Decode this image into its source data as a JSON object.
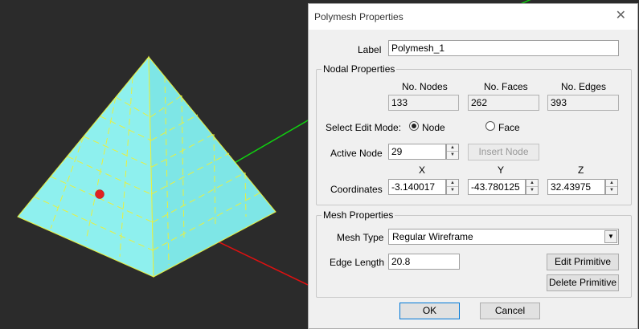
{
  "dialog": {
    "title": "Polymesh Properties",
    "label_caption": "Label",
    "label_value": "Polymesh_1",
    "nodal": {
      "title": "Nodal Properties",
      "nodes_header": "No. Nodes",
      "faces_header": "No. Faces",
      "edges_header": "No. Edges",
      "nodes_value": "133",
      "faces_value": "262",
      "edges_value": "393",
      "edit_mode_label": "Select Edit Mode:",
      "mode_node": "Node",
      "mode_face": "Face",
      "mode_selected": "Node",
      "active_node_label": "Active Node",
      "active_node_value": "29",
      "insert_node_label": "Insert Node",
      "x_header": "X",
      "y_header": "Y",
      "z_header": "Z",
      "coordinates_label": "Coordinates",
      "x_value": "-3.140017",
      "y_value": "-43.780125",
      "z_value": "32.43975"
    },
    "mesh": {
      "title": "Mesh Properties",
      "mesh_type_label": "Mesh Type",
      "mesh_type_value": "Regular Wireframe",
      "edge_length_label": "Edge Length",
      "edge_length_value": "20.8",
      "edit_primitive_label": "Edit Primitive",
      "delete_primitive_label": "Delete Primitive"
    },
    "ok_label": "OK",
    "cancel_label": "Cancel"
  },
  "viewport": {
    "background": "#2b2b2b",
    "mesh_color": "#8ef0ee",
    "wire_color": "#e8f040",
    "active_node_color": "#e02020",
    "axis_colors": {
      "x": "#e01010",
      "y": "#10d010"
    }
  }
}
